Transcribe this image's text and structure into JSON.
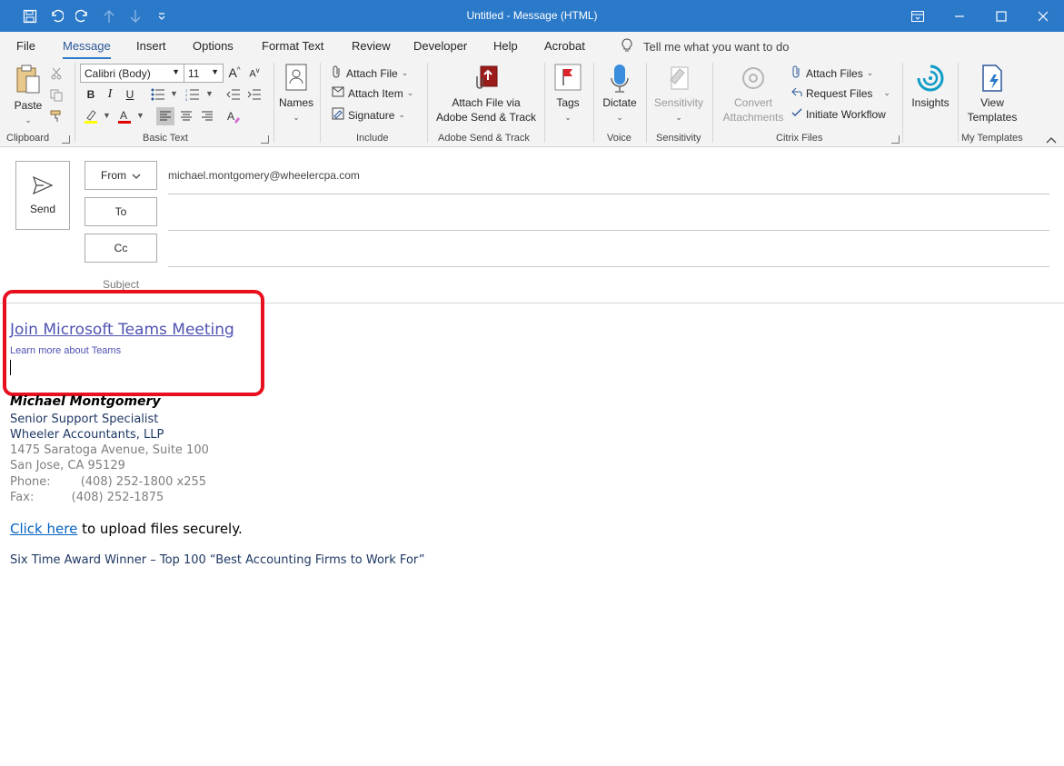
{
  "window": {
    "title": "Untitled  -  Message (HTML)"
  },
  "menu": {
    "tabs": [
      "File",
      "Message",
      "Insert",
      "Options",
      "Format Text",
      "Review",
      "Developer",
      "Help",
      "Acrobat"
    ],
    "active": "Message",
    "tell_me": "Tell me what you want to do"
  },
  "ribbon": {
    "clipboard": {
      "label": "Clipboard",
      "paste": "Paste"
    },
    "basic_text": {
      "label": "Basic Text",
      "font": "Calibri (Body)",
      "size": "11",
      "bold": "B",
      "italic": "I",
      "underline": "U"
    },
    "names": {
      "label": "Names"
    },
    "include": {
      "label": "Include",
      "attach_file": "Attach File",
      "attach_item": "Attach Item",
      "signature": "Signature"
    },
    "adobe": {
      "label": "Adobe Send & Track",
      "button_line1": "Attach File via",
      "button_line2": "Adobe Send & Track"
    },
    "tags": {
      "label": "Tags"
    },
    "voice": {
      "label": "Voice",
      "dictate": "Dictate"
    },
    "sensitivity": {
      "label": "Sensitivity",
      "button": "Sensitivity"
    },
    "citrix": {
      "label": "Citrix Files",
      "convert_line1": "Convert",
      "convert_line2": "Attachments",
      "attach_files": "Attach Files",
      "request_files": "Request Files",
      "initiate_workflow": "Initiate Workflow"
    },
    "insights": {
      "label": "Insights"
    },
    "templates": {
      "label": "My Templates",
      "line1": "View",
      "line2": "Templates"
    }
  },
  "header": {
    "send": "Send",
    "from": "From",
    "from_address": "michael.montgomery@wheelercpa.com",
    "to": "To",
    "cc": "Cc",
    "subject": "Subject"
  },
  "body": {
    "teams_link": "Join Microsoft Teams Meeting",
    "teams_learn": "Learn more about Teams",
    "sig_name": "Michael Montgomery",
    "sig_title": "Senior Support Specialist",
    "sig_company": "Wheeler Accountants, LLP",
    "sig_address1": "1475 Saratoga Avenue, Suite 100",
    "sig_address2": "San Jose, CA 95129",
    "sig_phone": "Phone:        (408) 252-1800 x255",
    "sig_fax": "Fax:          (408) 252-1875",
    "click_here": "Click here",
    "click_rest": " to upload files securely.",
    "award": "Six Time Award Winner – Top 100 “Best Accounting Firms to Work For”"
  },
  "colors": {
    "titlebar": "#2b79c9",
    "teams_link": "#4f52b2",
    "highlight_box": "#e8101e",
    "hyperlink": "#0563c1"
  }
}
